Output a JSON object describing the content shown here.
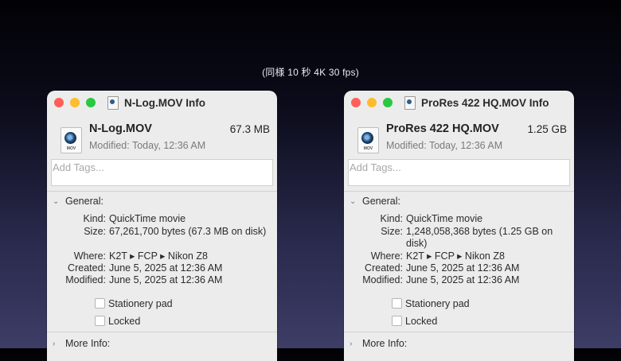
{
  "caption": "(同様 10 秒 4K 30 fps)",
  "windows": [
    {
      "title": "N-Log.MOV Info",
      "file_name": "N-Log.MOV",
      "size_short": "67.3 MB",
      "modified_summary": "Modified: Today, 12:36 AM",
      "icon_ext": "MOV",
      "tags_placeholder": "Add Tags...",
      "general_label": "General:",
      "kind_key": "Kind:",
      "kind_value": "QuickTime movie",
      "size_key": "Size:",
      "size_value": "67,261,700 bytes (67.3 MB on disk)",
      "where_key": "Where:",
      "where_value": "K2T ▸ FCP ▸ Nikon Z8",
      "created_key": "Created:",
      "created_value": "June 5, 2025 at 12:36 AM",
      "modified_key": "Modified:",
      "modified_value": "June 5, 2025 at 12:36 AM",
      "stationery_label": "Stationery pad",
      "locked_label": "Locked",
      "more_info_label": "More Info:"
    },
    {
      "title": "ProRes 422 HQ.MOV Info",
      "file_name": "ProRes 422 HQ.MOV",
      "size_short": "1.25 GB",
      "modified_summary": "Modified: Today, 12:36 AM",
      "icon_ext": "MOV",
      "tags_placeholder": "Add Tags...",
      "general_label": "General:",
      "kind_key": "Kind:",
      "kind_value": "QuickTime movie",
      "size_key": "Size:",
      "size_value": "1,248,058,368 bytes (1.25 GB on disk)",
      "where_key": "Where:",
      "where_value": "K2T ▸ FCP ▸ Nikon Z8",
      "created_key": "Created:",
      "created_value": "June 5, 2025 at 12:36 AM",
      "modified_key": "Modified:",
      "modified_value": "June 5, 2025 at 12:36 AM",
      "stationery_label": "Stationery pad",
      "locked_label": "Locked",
      "more_info_label": "More Info:"
    }
  ]
}
